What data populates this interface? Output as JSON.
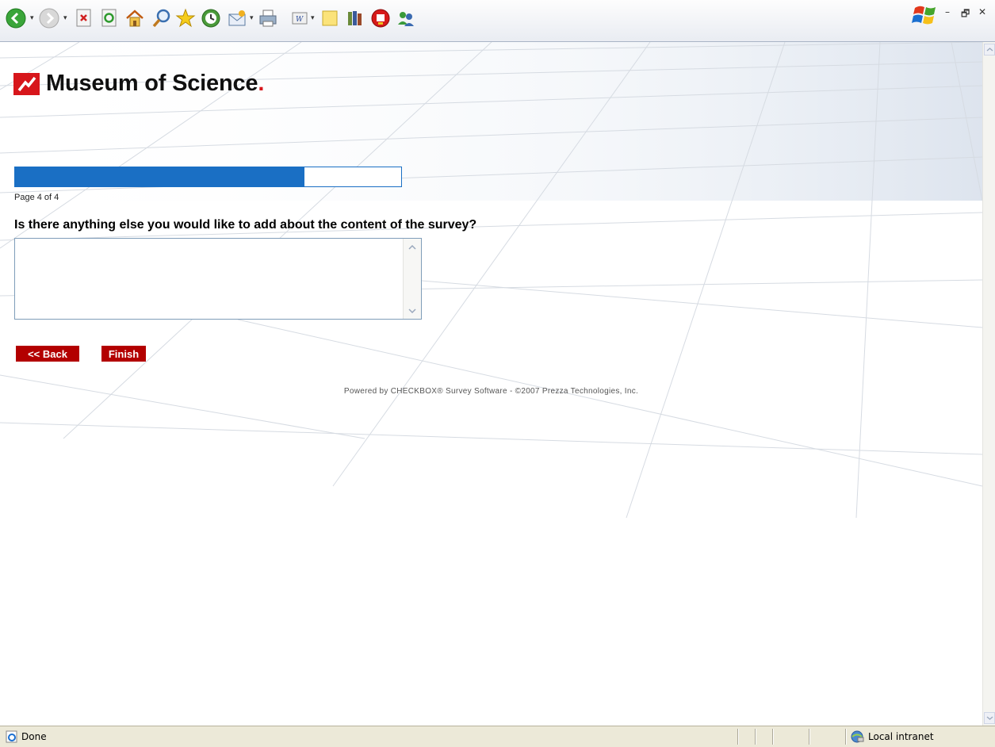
{
  "toolbar": {
    "icons": [
      "back-icon",
      "forward-icon",
      "stop-icon",
      "refresh-icon",
      "home-icon",
      "search-icon",
      "favorites-icon",
      "history-icon",
      "mail-icon",
      "print-icon",
      "edit-icon",
      "notes-icon",
      "research-icon",
      "messenger-icon",
      "contacts-icon"
    ]
  },
  "logo": {
    "name": "Museum of Science"
  },
  "survey": {
    "progress_fraction": 0.75,
    "page_label": "Page 4 of 4",
    "question": "Is there anything else you would like to add about the content of the survey?",
    "answer_value": "",
    "back_label": "<< Back",
    "finish_label": "Finish",
    "footer": "Powered by CHECKBOX® Survey Software - ©2007 Prezza Technologies, Inc."
  },
  "statusbar": {
    "status": "Done",
    "zone": "Local intranet"
  },
  "colors": {
    "brand_red": "#d7161b",
    "progress_blue": "#1a6fc4",
    "button_red": "#b30000"
  }
}
